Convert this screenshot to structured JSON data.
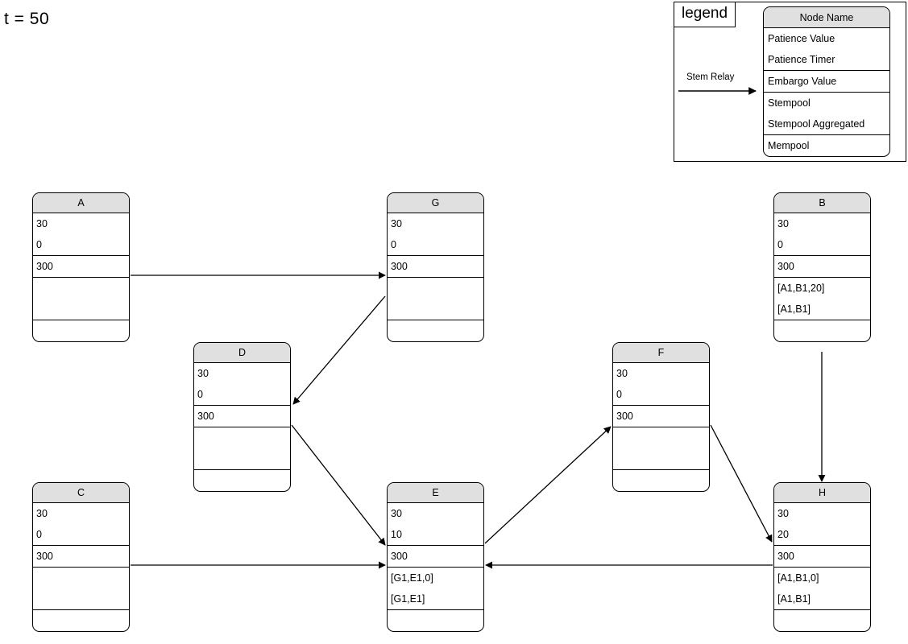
{
  "title": "t = 50",
  "legend": {
    "tab_label": "legend",
    "edge_label": "Stem Relay",
    "node_template": {
      "header": "Node Name",
      "patience_value": "Patience Value",
      "patience_timer": "Patience Timer",
      "embargo_value": "Embargo Value",
      "stempool": "Stempool",
      "stempool_aggregated": "Stempool Aggregated",
      "mempool": "Mempool"
    }
  },
  "nodes": [
    {
      "id": "A",
      "name": "A",
      "patience_value": "30",
      "patience_timer": "0",
      "embargo_value": "300",
      "stempool": "",
      "stempool_aggregated": "",
      "mempool": ""
    },
    {
      "id": "B",
      "name": "B",
      "patience_value": "30",
      "patience_timer": "0",
      "embargo_value": "300",
      "stempool": "[A1,B1,20]",
      "stempool_aggregated": "[A1,B1]",
      "mempool": ""
    },
    {
      "id": "C",
      "name": "C",
      "patience_value": "30",
      "patience_timer": "0",
      "embargo_value": "300",
      "stempool": "",
      "stempool_aggregated": "",
      "mempool": ""
    },
    {
      "id": "D",
      "name": "D",
      "patience_value": "30",
      "patience_timer": "0",
      "embargo_value": "300",
      "stempool": "",
      "stempool_aggregated": "",
      "mempool": ""
    },
    {
      "id": "E",
      "name": "E",
      "patience_value": "30",
      "patience_timer": "10",
      "embargo_value": "300",
      "stempool": "[G1,E1,0]",
      "stempool_aggregated": "[G1,E1]",
      "mempool": ""
    },
    {
      "id": "F",
      "name": "F",
      "patience_value": "30",
      "patience_timer": "0",
      "embargo_value": "300",
      "stempool": "",
      "stempool_aggregated": "",
      "mempool": ""
    },
    {
      "id": "G",
      "name": "G",
      "patience_value": "30",
      "patience_timer": "0",
      "embargo_value": "300",
      "stempool": "",
      "stempool_aggregated": "",
      "mempool": ""
    },
    {
      "id": "H",
      "name": "H",
      "patience_value": "30",
      "patience_timer": "20",
      "embargo_value": "300",
      "stempool": "[A1,B1,0]",
      "stempool_aggregated": "[A1,B1]",
      "mempool": ""
    }
  ],
  "edges": [
    {
      "from": "A",
      "to": "G",
      "kind": "stem-relay"
    },
    {
      "from": "G",
      "to": "D",
      "kind": "stem-relay"
    },
    {
      "from": "D",
      "to": "E",
      "kind": "stem-relay"
    },
    {
      "from": "C",
      "to": "E",
      "kind": "stem-relay"
    },
    {
      "from": "E",
      "to": "F",
      "kind": "stem-relay"
    },
    {
      "from": "F",
      "to": "H",
      "kind": "stem-relay"
    },
    {
      "from": "B",
      "to": "H",
      "kind": "stem-relay"
    },
    {
      "from": "H",
      "to": "E",
      "kind": "stem-relay"
    }
  ],
  "colors": {
    "header_fill": "#e0e0e0",
    "stroke": "#000000",
    "background": "#ffffff"
  }
}
